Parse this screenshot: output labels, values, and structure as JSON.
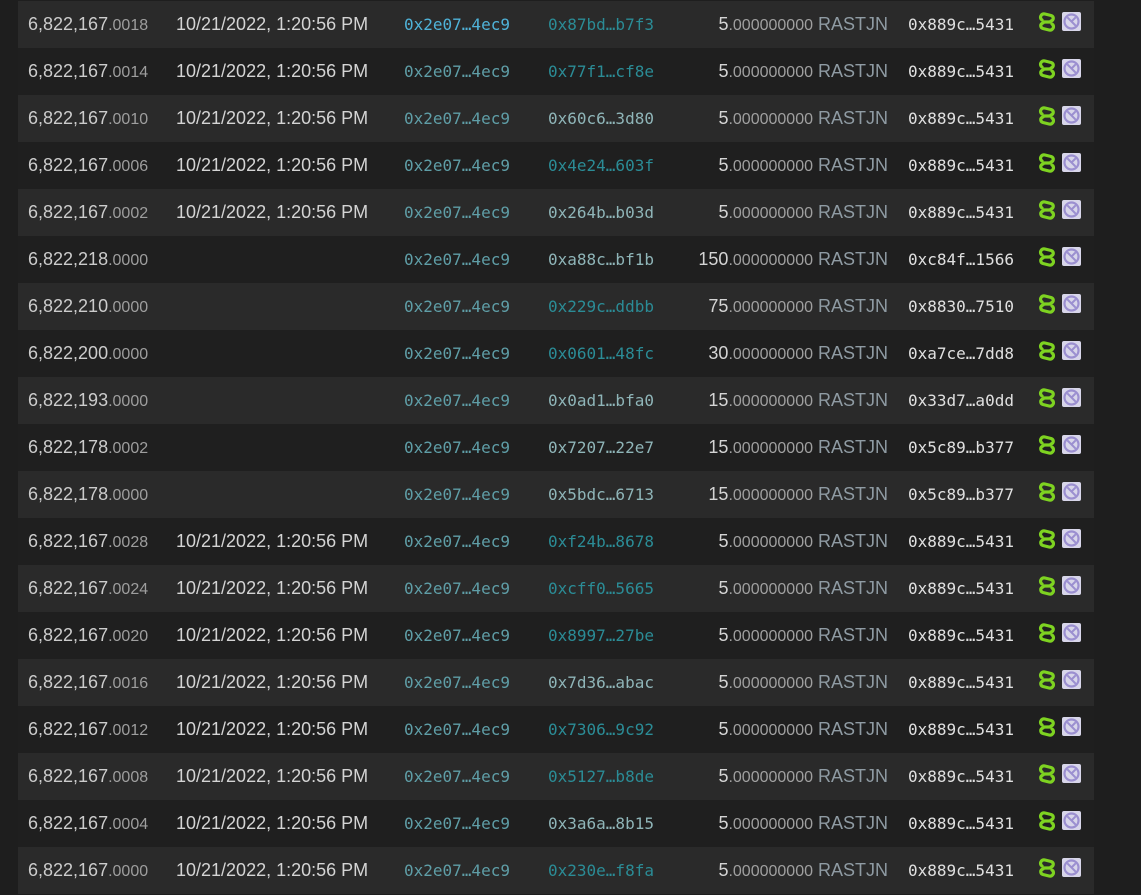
{
  "colors": {
    "row_odd": "#2a2a2a",
    "row_even": "#1f1f1f",
    "link_icon": "#7ed321",
    "asset_icon": "#9b8fd0"
  },
  "rows": [
    {
      "block_int": "6,822,167",
      "block_frac": ".0018",
      "time": "10/21/2022, 1:20:56 PM",
      "from": "0x2e07…4ec9",
      "from_highlight": true,
      "to": "0x87bd…b7f3",
      "to_style": "hash",
      "amount_int": "5",
      "amount_dec": ".000000000",
      "token": "RASTJN",
      "owner": "0x889c…5431"
    },
    {
      "block_int": "6,822,167",
      "block_frac": ".0014",
      "time": "10/21/2022, 1:20:56 PM",
      "from": "0x2e07…4ec9",
      "from_highlight": false,
      "to": "0x77f1…cf8e",
      "to_style": "hash",
      "amount_int": "5",
      "amount_dec": ".000000000",
      "token": "RASTJN",
      "owner": "0x889c…5431"
    },
    {
      "block_int": "6,822,167",
      "block_frac": ".0010",
      "time": "10/21/2022, 1:20:56 PM",
      "from": "0x2e07…4ec9",
      "from_highlight": false,
      "to": "0x60c6…3d80",
      "to_style": "plain",
      "amount_int": "5",
      "amount_dec": ".000000000",
      "token": "RASTJN",
      "owner": "0x889c…5431"
    },
    {
      "block_int": "6,822,167",
      "block_frac": ".0006",
      "time": "10/21/2022, 1:20:56 PM",
      "from": "0x2e07…4ec9",
      "from_highlight": false,
      "to": "0x4e24…603f",
      "to_style": "hash",
      "amount_int": "5",
      "amount_dec": ".000000000",
      "token": "RASTJN",
      "owner": "0x889c…5431"
    },
    {
      "block_int": "6,822,167",
      "block_frac": ".0002",
      "time": "10/21/2022, 1:20:56 PM",
      "from": "0x2e07…4ec9",
      "from_highlight": false,
      "to": "0x264b…b03d",
      "to_style": "plain",
      "amount_int": "5",
      "amount_dec": ".000000000",
      "token": "RASTJN",
      "owner": "0x889c…5431"
    },
    {
      "block_int": "6,822,218",
      "block_frac": ".0000",
      "time": "",
      "from": "0x2e07…4ec9",
      "from_highlight": false,
      "to": "0xa88c…bf1b",
      "to_style": "plain",
      "amount_int": "150",
      "amount_dec": ".000000000",
      "token": "RASTJN",
      "owner": "0xc84f…1566"
    },
    {
      "block_int": "6,822,210",
      "block_frac": ".0000",
      "time": "",
      "from": "0x2e07…4ec9",
      "from_highlight": false,
      "to": "0x229c…ddbb",
      "to_style": "hash",
      "amount_int": "75",
      "amount_dec": ".000000000",
      "token": "RASTJN",
      "owner": "0x8830…7510"
    },
    {
      "block_int": "6,822,200",
      "block_frac": ".0000",
      "time": "",
      "from": "0x2e07…4ec9",
      "from_highlight": false,
      "to": "0x0601…48fc",
      "to_style": "hash",
      "amount_int": "30",
      "amount_dec": ".000000000",
      "token": "RASTJN",
      "owner": "0xa7ce…7dd8"
    },
    {
      "block_int": "6,822,193",
      "block_frac": ".0000",
      "time": "",
      "from": "0x2e07…4ec9",
      "from_highlight": false,
      "to": "0x0ad1…bfa0",
      "to_style": "plain",
      "amount_int": "15",
      "amount_dec": ".000000000",
      "token": "RASTJN",
      "owner": "0x33d7…a0dd"
    },
    {
      "block_int": "6,822,178",
      "block_frac": ".0002",
      "time": "",
      "from": "0x2e07…4ec9",
      "from_highlight": false,
      "to": "0x7207…22e7",
      "to_style": "plain",
      "amount_int": "15",
      "amount_dec": ".000000000",
      "token": "RASTJN",
      "owner": "0x5c89…b377"
    },
    {
      "block_int": "6,822,178",
      "block_frac": ".0000",
      "time": "",
      "from": "0x2e07…4ec9",
      "from_highlight": false,
      "to": "0x5bdc…6713",
      "to_style": "plain",
      "amount_int": "15",
      "amount_dec": ".000000000",
      "token": "RASTJN",
      "owner": "0x5c89…b377"
    },
    {
      "block_int": "6,822,167",
      "block_frac": ".0028",
      "time": "10/21/2022, 1:20:56 PM",
      "from": "0x2e07…4ec9",
      "from_highlight": false,
      "to": "0xf24b…8678",
      "to_style": "hash",
      "amount_int": "5",
      "amount_dec": ".000000000",
      "token": "RASTJN",
      "owner": "0x889c…5431"
    },
    {
      "block_int": "6,822,167",
      "block_frac": ".0024",
      "time": "10/21/2022, 1:20:56 PM",
      "from": "0x2e07…4ec9",
      "from_highlight": false,
      "to": "0xcff0…5665",
      "to_style": "hash",
      "amount_int": "5",
      "amount_dec": ".000000000",
      "token": "RASTJN",
      "owner": "0x889c…5431"
    },
    {
      "block_int": "6,822,167",
      "block_frac": ".0020",
      "time": "10/21/2022, 1:20:56 PM",
      "from": "0x2e07…4ec9",
      "from_highlight": false,
      "to": "0x8997…27be",
      "to_style": "hash",
      "amount_int": "5",
      "amount_dec": ".000000000",
      "token": "RASTJN",
      "owner": "0x889c…5431"
    },
    {
      "block_int": "6,822,167",
      "block_frac": ".0016",
      "time": "10/21/2022, 1:20:56 PM",
      "from": "0x2e07…4ec9",
      "from_highlight": false,
      "to": "0x7d36…abac",
      "to_style": "plain",
      "amount_int": "5",
      "amount_dec": ".000000000",
      "token": "RASTJN",
      "owner": "0x889c…5431"
    },
    {
      "block_int": "6,822,167",
      "block_frac": ".0012",
      "time": "10/21/2022, 1:20:56 PM",
      "from": "0x2e07…4ec9",
      "from_highlight": false,
      "to": "0x7306…9c92",
      "to_style": "hash",
      "amount_int": "5",
      "amount_dec": ".000000000",
      "token": "RASTJN",
      "owner": "0x889c…5431"
    },
    {
      "block_int": "6,822,167",
      "block_frac": ".0008",
      "time": "10/21/2022, 1:20:56 PM",
      "from": "0x2e07…4ec9",
      "from_highlight": false,
      "to": "0x5127…b8de",
      "to_style": "hash",
      "amount_int": "5",
      "amount_dec": ".000000000",
      "token": "RASTJN",
      "owner": "0x889c…5431"
    },
    {
      "block_int": "6,822,167",
      "block_frac": ".0004",
      "time": "10/21/2022, 1:20:56 PM",
      "from": "0x2e07…4ec9",
      "from_highlight": false,
      "to": "0x3a6a…8b15",
      "to_style": "plain",
      "amount_int": "5",
      "amount_dec": ".000000000",
      "token": "RASTJN",
      "owner": "0x889c…5431"
    },
    {
      "block_int": "6,822,167",
      "block_frac": ".0000",
      "time": "10/21/2022, 1:20:56 PM",
      "from": "0x2e07…4ec9",
      "from_highlight": false,
      "to": "0x230e…f8fa",
      "to_style": "hash",
      "amount_int": "5",
      "amount_dec": ".000000000",
      "token": "RASTJN",
      "owner": "0x889c…5431"
    }
  ]
}
